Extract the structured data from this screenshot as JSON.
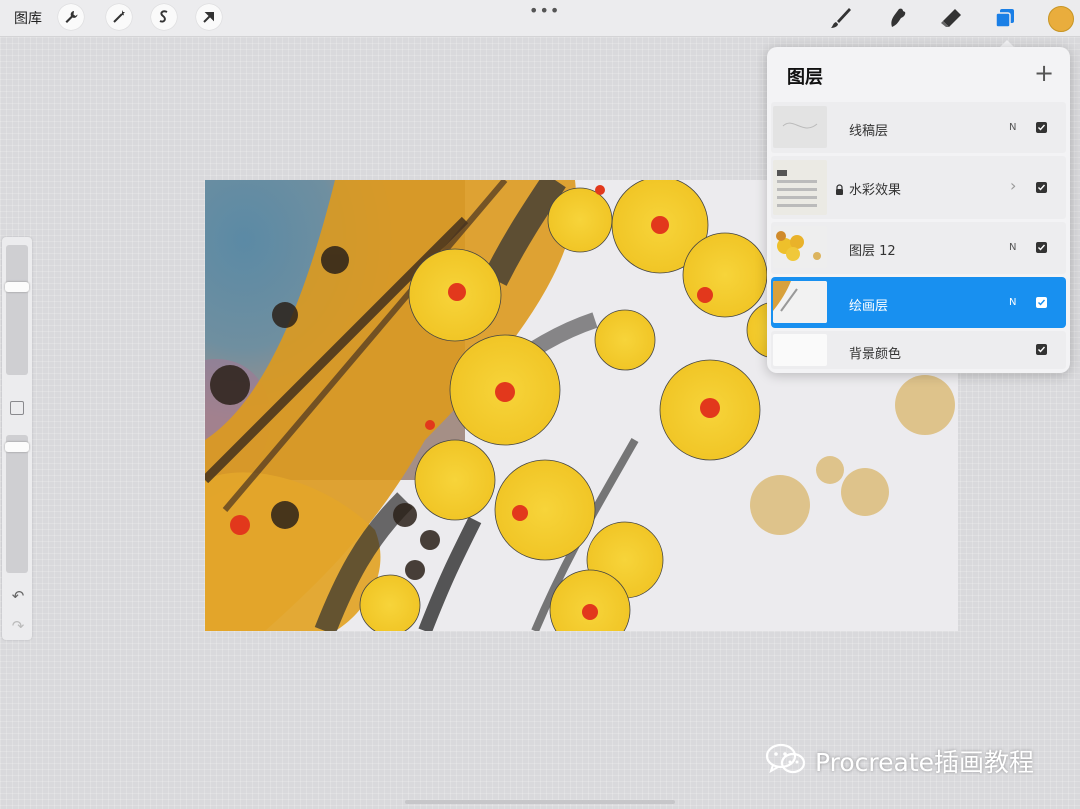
{
  "toolbar": {
    "gallery_label": "图库",
    "more_dots": "•••",
    "color_hex": "#e9ad3d",
    "active_tool_color": "#1a7fe6",
    "left_tools": [
      "wrench-icon",
      "magic-wand-icon",
      "selection-s-icon",
      "transform-arrow-icon"
    ],
    "right_tools": [
      "brush-icon",
      "smudge-icon",
      "eraser-icon",
      "layers-icon"
    ]
  },
  "layers_panel": {
    "title": "图层",
    "add_symbol": "+",
    "layers": [
      {
        "name": "线稿层",
        "blend": "N",
        "visible": true,
        "locked": false,
        "active": false
      },
      {
        "name": "水彩效果",
        "blend": "",
        "visible": true,
        "locked": true,
        "active": false,
        "is_group": true
      },
      {
        "name": "图层 12",
        "blend": "N",
        "visible": true,
        "locked": false,
        "active": false
      },
      {
        "name": "绘画层",
        "blend": "N",
        "visible": true,
        "locked": false,
        "active": true
      },
      {
        "name": "背景颜色",
        "blend": "",
        "visible": true,
        "locked": false,
        "active": false
      }
    ]
  },
  "sidebar": {
    "undo": "↶",
    "redo": "↷"
  },
  "watermark": {
    "text": "Procreate插画教程"
  }
}
